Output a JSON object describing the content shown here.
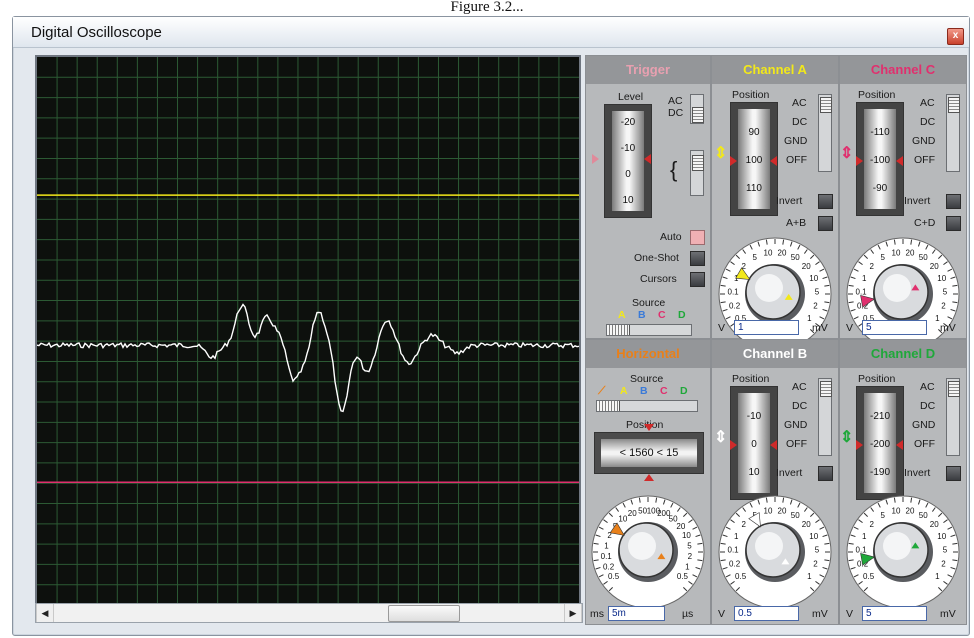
{
  "caption": "Figure 3.2...",
  "window": {
    "title": "Digital Oscilloscope",
    "close_label": "x"
  },
  "colors": {
    "channel_a": "#f2e81a",
    "channel_b": "#ffffff",
    "channel_c": "#e0306e",
    "channel_d": "#1fa83a",
    "horizontal": "#e8801a",
    "trigger": "#e05a78",
    "screen_bg": "#0d100d",
    "grid": "#2c5a34"
  },
  "screen": {
    "traces": {
      "channel_a_level": 0.252,
      "channel_c_level": 0.776,
      "channel_b_baseline": 0.526
    }
  },
  "trigger": {
    "title": "Trigger",
    "level_label": "Level",
    "drum_values": [
      "-20",
      "-10",
      "0",
      "10"
    ],
    "ac": "AC",
    "dc": "DC",
    "auto": "Auto",
    "one_shot": "One-Shot",
    "cursors": "Cursors",
    "source_label": "Source",
    "source_a": "A",
    "source_b": "B",
    "source_c": "C",
    "source_d": "D"
  },
  "horizontal": {
    "title": "Horizontal",
    "source_label": "Source",
    "source_a": "A",
    "source_b": "B",
    "source_c": "C",
    "source_d": "D",
    "position_label": "Position",
    "position_value": "< 1560 < 15",
    "knob_scale": [
      "0.5",
      "0.2",
      "0.1",
      "1",
      "2",
      "5",
      "10",
      "20",
      "50",
      "100",
      "200",
      "50",
      "20",
      "10",
      "5",
      "2",
      "1",
      "0.5"
    ],
    "unit_left": "ms",
    "unit_right": "µs",
    "value": "5m"
  },
  "channels": {
    "a": {
      "title": "Channel A",
      "position_label": "Position",
      "drum_values": [
        "90",
        "100",
        "110"
      ],
      "ac": "AC",
      "dc": "DC",
      "gnd": "GND",
      "off": "OFF",
      "invert": "Invert",
      "combine": "A+B",
      "unit_left": "V",
      "unit_right": "mV",
      "value": "1",
      "knob_scale": [
        "0.5",
        "0.2",
        "0.1",
        "1",
        "2",
        "5",
        "10",
        "20",
        "50",
        "20",
        "10",
        "5",
        "2",
        "1"
      ]
    },
    "b": {
      "title": "Channel B",
      "position_label": "Position",
      "drum_values": [
        "-10",
        "0",
        "10"
      ],
      "ac": "AC",
      "dc": "DC",
      "gnd": "GND",
      "off": "OFF",
      "invert": "Invert",
      "unit_left": "V",
      "unit_right": "mV",
      "value": "0.5",
      "knob_scale": [
        "0.5",
        "0.2",
        "0.1",
        "1",
        "2",
        "5",
        "10",
        "20",
        "50",
        "20",
        "10",
        "5",
        "2",
        "1"
      ]
    },
    "c": {
      "title": "Channel C",
      "position_label": "Position",
      "drum_values": [
        "-110",
        "-100",
        "-90"
      ],
      "ac": "AC",
      "dc": "DC",
      "gnd": "GND",
      "off": "OFF",
      "invert": "Invert",
      "combine": "C+D",
      "unit_left": "V",
      "unit_right": "mV",
      "value": "5",
      "knob_scale": [
        "0.5",
        "0.2",
        "0.1",
        "1",
        "2",
        "5",
        "10",
        "20",
        "50",
        "20",
        "10",
        "5",
        "2",
        "1"
      ]
    },
    "d": {
      "title": "Channel D",
      "position_label": "Position",
      "drum_values": [
        "-210",
        "-200",
        "-190"
      ],
      "ac": "AC",
      "dc": "DC",
      "gnd": "GND",
      "off": "OFF",
      "invert": "Invert",
      "unit_left": "V",
      "unit_right": "mV",
      "value": "5",
      "knob_scale": [
        "0.5",
        "0.2",
        "0.1",
        "1",
        "2",
        "5",
        "10",
        "20",
        "50",
        "20",
        "10",
        "5",
        "2",
        "1"
      ]
    }
  },
  "scrollbar": {
    "left_arrow": "◀",
    "right_arrow": "▶"
  }
}
